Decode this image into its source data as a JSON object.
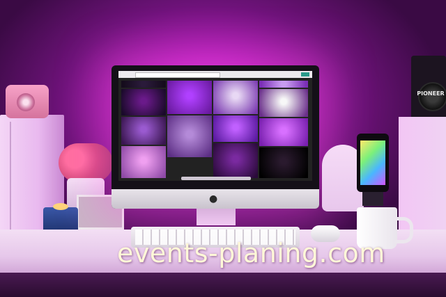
{
  "scene": {
    "description_kind": "photograph",
    "watermark_text": "events-planing.com",
    "speaker_label": "PIONEER",
    "colors": {
      "ambient_light": "#e23fe0",
      "wall_dark": "#3a0a44",
      "desk": "#f3dff4",
      "watermark": "#fff8d8"
    }
  },
  "screen": {
    "tiles": [
      {
        "color_a": "#2a1a3a",
        "color_b": "#150c1c"
      },
      {
        "color_a": "#b040ff",
        "color_b": "#6a1aa0"
      },
      {
        "color_a": "#e8d8f4",
        "color_b": "#7a3ab0"
      },
      {
        "color_a": "#c89cf0",
        "color_b": "#7b2fb8"
      },
      {
        "color_a": "#6a1a8a",
        "color_b": "#1a0a2a"
      },
      {
        "color_a": "#f7f7f7",
        "color_b": "#6a2f8a"
      },
      {
        "color_a": "#9a5ad0",
        "color_b": "#3a1650"
      },
      {
        "color_a": "#b48ad8",
        "color_b": "#5c2e84"
      },
      {
        "color_a": "#c060ff",
        "color_b": "#5a1aa0"
      },
      {
        "color_a": "#d870ff",
        "color_b": "#7a20b0"
      },
      {
        "color_a": "#7a2aa0",
        "color_b": "#2a0a3a"
      },
      {
        "color_a": "#ef9ff0",
        "color_b": "#8e4aa6"
      },
      {
        "color_a": "#2a1a2e",
        "color_b": "#000000"
      }
    ]
  }
}
